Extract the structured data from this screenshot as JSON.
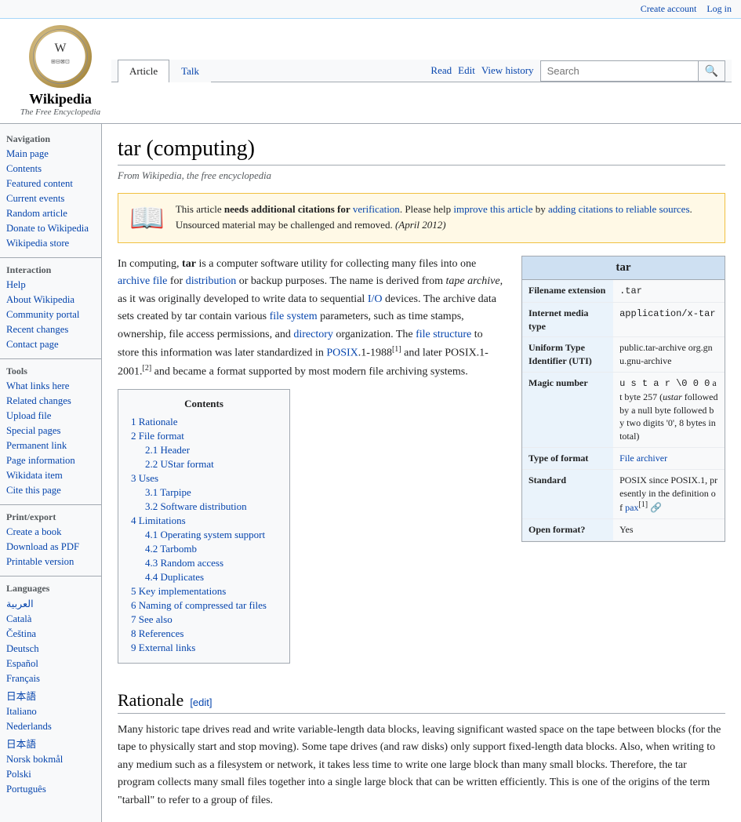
{
  "topbar": {
    "create_account": "Create account",
    "log_in": "Log in"
  },
  "logo": {
    "title": "Wikipedia",
    "subtitle": "The Free Encyclopedia"
  },
  "tabs": {
    "article": "Article",
    "talk": "Talk",
    "read": "Read",
    "edit": "Edit",
    "view_history": "View history"
  },
  "search": {
    "placeholder": "Search",
    "button": "🔍"
  },
  "sidebar": {
    "navigation_title": "Navigation",
    "nav_items": [
      {
        "label": "Main page",
        "href": "#"
      },
      {
        "label": "Contents",
        "href": "#"
      },
      {
        "label": "Featured content",
        "href": "#"
      },
      {
        "label": "Current events",
        "href": "#"
      },
      {
        "label": "Random article",
        "href": "#"
      },
      {
        "label": "Donate to Wikipedia",
        "href": "#"
      },
      {
        "label": "Wikipedia store",
        "href": "#"
      }
    ],
    "interaction_title": "Interaction",
    "interaction_items": [
      {
        "label": "Help",
        "href": "#"
      },
      {
        "label": "About Wikipedia",
        "href": "#"
      },
      {
        "label": "Community portal",
        "href": "#"
      },
      {
        "label": "Recent changes",
        "href": "#"
      },
      {
        "label": "Contact page",
        "href": "#"
      }
    ],
    "tools_title": "Tools",
    "tools_items": [
      {
        "label": "What links here",
        "href": "#"
      },
      {
        "label": "Related changes",
        "href": "#"
      },
      {
        "label": "Upload file",
        "href": "#"
      },
      {
        "label": "Special pages",
        "href": "#"
      },
      {
        "label": "Permanent link",
        "href": "#"
      },
      {
        "label": "Page information",
        "href": "#"
      },
      {
        "label": "Wikidata item",
        "href": "#"
      },
      {
        "label": "Cite this page",
        "href": "#"
      }
    ],
    "print_title": "Print/export",
    "print_items": [
      {
        "label": "Create a book",
        "href": "#"
      },
      {
        "label": "Download as PDF",
        "href": "#"
      },
      {
        "label": "Printable version",
        "href": "#"
      }
    ],
    "languages_title": "Languages",
    "language_items": [
      {
        "label": "العربية",
        "href": "#"
      },
      {
        "label": "Català",
        "href": "#"
      },
      {
        "label": "Čeština",
        "href": "#"
      },
      {
        "label": "Deutsch",
        "href": "#"
      },
      {
        "label": "Español",
        "href": "#"
      },
      {
        "label": "Français",
        "href": "#"
      },
      {
        "label": "日本語",
        "href": "#"
      },
      {
        "label": "Italiano",
        "href": "#"
      },
      {
        "label": "Nederlands",
        "href": "#"
      },
      {
        "label": "日本語",
        "href": "#"
      },
      {
        "label": "Norsk bokmål",
        "href": "#"
      },
      {
        "label": "Polski",
        "href": "#"
      },
      {
        "label": "Português",
        "href": "#"
      }
    ]
  },
  "article": {
    "title": "tar (computing)",
    "subtitle": "From Wikipedia, the free encyclopedia",
    "warning": {
      "icon": "📖",
      "text_part1": "This article ",
      "bold": "needs additional citations for",
      "link": "verification",
      "text_part2": ". Please help ",
      "improve_link": "improve this article",
      "text_part3": " by ",
      "adding_link": "adding citations to reliable sources",
      "text_part4": ". Unsourced material may be challenged and removed. ",
      "date": "(April 2012)"
    },
    "intro": "In computing, <b>tar</b> is a computer software utility for collecting many files into one <a href='#'>archive file</a> for <a href='#'>distribution</a> or backup purposes. The name is derived from <i>tape archive</i>, as it was originally developed to write data to sequential <a href='#'>I/O</a> devices. The archive data sets created by tar contain various <a href='#'>file system</a> parameters, such as time stamps, ownership, file access permissions, and <a href='#'>directory</a> organization. The <a href='#'>file structure</a> to store this information was later standardized in <a href='#'>POSIX</a>.1-1988<sup>[1]</sup> and later POSIX.1-2001.<sup>[2]</sup> and became a format supported by most modern file archiving systems.",
    "infobox": {
      "title": "tar",
      "rows": [
        {
          "label": "Filename extension",
          "value": ".tar"
        },
        {
          "label": "Internet media type",
          "value": "application/x-tar"
        },
        {
          "label": "Uniform Type Identifier (UTI)",
          "value": "public.tar-archive org.gnu.gnu-archive"
        },
        {
          "label": "Magic number",
          "value": "u s t a r \\0 0 0 at byte 257 (ustar followed by a null byte followed by two digits '0', 8 bytes in total)"
        },
        {
          "label": "Type of format",
          "value": "File archiver",
          "is_link": true
        },
        {
          "label": "Standard",
          "value": "POSIX since POSIX.1, presently in the definition of pax[1]"
        },
        {
          "label": "Open format?",
          "value": "Yes"
        }
      ]
    },
    "toc": {
      "title": "Contents",
      "items": [
        {
          "num": "1",
          "label": "Rationale",
          "href": "#rationale"
        },
        {
          "num": "2",
          "label": "File format",
          "href": "#fileformat"
        },
        {
          "sub": [
            {
              "num": "2.1",
              "label": "Header",
              "href": "#header"
            },
            {
              "num": "2.2",
              "label": "UStar format",
              "href": "#ustar"
            }
          ]
        },
        {
          "num": "3",
          "label": "Uses",
          "href": "#uses"
        },
        {
          "sub": [
            {
              "num": "3.1",
              "label": "Tarpipe",
              "href": "#tarpipe"
            },
            {
              "num": "3.2",
              "label": "Software distribution",
              "href": "#softdist"
            }
          ]
        },
        {
          "num": "4",
          "label": "Limitations",
          "href": "#limitations"
        },
        {
          "sub": [
            {
              "num": "4.1",
              "label": "Operating system support",
              "href": "#ossupport"
            },
            {
              "num": "4.2",
              "label": "Tarbomb",
              "href": "#tarbomb"
            },
            {
              "num": "4.3",
              "label": "Random access",
              "href": "#randomaccess"
            },
            {
              "num": "4.4",
              "label": "Duplicates",
              "href": "#duplicates"
            }
          ]
        },
        {
          "num": "5",
          "label": "Key implementations",
          "href": "#keyimpl"
        },
        {
          "num": "6",
          "label": "Naming of compressed tar files",
          "href": "#naming"
        },
        {
          "num": "7",
          "label": "See also",
          "href": "#seealso"
        },
        {
          "num": "8",
          "label": "References",
          "href": "#references"
        },
        {
          "num": "9",
          "label": "External links",
          "href": "#extlinks"
        }
      ]
    },
    "sections": {
      "rationale": {
        "title": "Rationale",
        "edit_label": "[edit]",
        "text": "Many historic tape drives read and write variable-length data blocks, leaving significant wasted space on the tape between blocks (for the tape to physically start and stop moving). Some tape drives (and raw disks) only support fixed-length data blocks. Also, when writing to any medium such as a filesystem or network, it takes less time to write one large block than many small blocks. Therefore, the tar program collects many small files together into a single large block that can be written efficiently. This is one of the origins of the term \"tarball\" to refer to a group of files."
      }
    }
  }
}
